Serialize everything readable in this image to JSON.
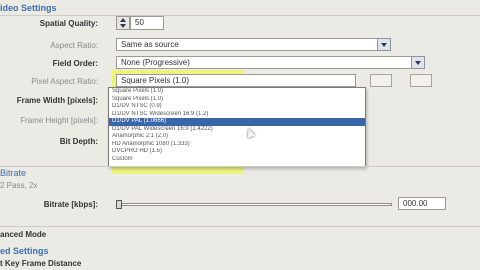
{
  "video_settings": {
    "section_title": "ideo Settings",
    "spatial_quality": {
      "label": "Spatial Quality:",
      "value": "50"
    },
    "aspect_ratio": {
      "label": "Aspect Ratio:",
      "value": "Same as source"
    },
    "field_order": {
      "label": "Field Order:",
      "value": "None (Progressive)"
    },
    "pixel_aspect_ratio": {
      "label": "Pixel Aspect Ratio:",
      "value": "Square Pixels (1.0)"
    },
    "frame_width": {
      "label": "Frame Width [pixels]:"
    },
    "frame_height": {
      "label": "Frame Height [pixels]:"
    },
    "bit_depth": {
      "label": "Bit Depth:"
    }
  },
  "pixel_aspect_dropdown": {
    "options": [
      "Square Pixels (1.0)",
      "Square Pixels (1.0)",
      "D1/DV NTSC (0.9)",
      "D1/DV NTSC Widescreen 16:9 (1.2)",
      "D1/DV PAL (1.0666)",
      "D1/DV PAL Widescreen 16:9 (1.4222)",
      "Anamorphic 2:1 (2.0)",
      "HD Anamorphic 1080 (1.333)",
      "DVCPRO HD (1.5)",
      "Custom"
    ],
    "selected_index": 4,
    "highlight_color": "#f0fa28"
  },
  "bitrate": {
    "section_title": "Bitrate",
    "mode_label": "2 Pass, 2x",
    "bitrate_label": "Bitrate [kbps]:",
    "value": "000.00",
    "slider_fraction": 0.0
  },
  "advanced": {
    "mode_label": "anced Mode",
    "section_title": "ed Settings",
    "key_frame_label": "t Key Frame Distance"
  },
  "colors": {
    "section_head": "#3d6fb0",
    "selection": "#3866a8",
    "panel_bg": "#eceae4"
  }
}
